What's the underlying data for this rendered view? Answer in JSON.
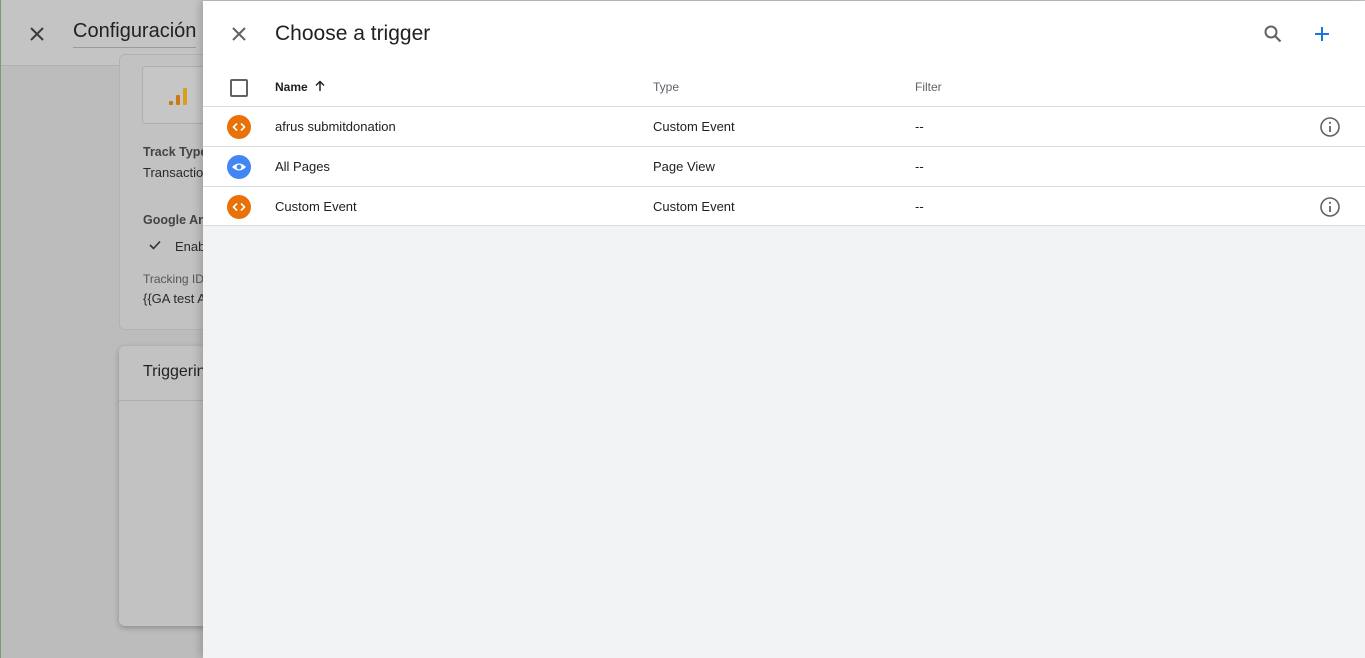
{
  "background": {
    "title": "Configuración",
    "track_type_label": "Track Type",
    "track_type_value": "Transactio",
    "ga_settings_label": "Google An",
    "enable_label": "Enab",
    "tracking_id_label": "Tracking ID",
    "tracking_id_value": "{{GA test A",
    "triggering_title": "Triggerin"
  },
  "panel": {
    "title": "Choose a trigger",
    "columns": {
      "name": "Name",
      "type": "Type",
      "filter": "Filter"
    },
    "rows": [
      {
        "name": "afrus submitdonation",
        "type": "Custom Event",
        "filter": "--",
        "icon": "code-icon",
        "icon_color": "#e8710a",
        "has_info": true
      },
      {
        "name": "All Pages",
        "type": "Page View",
        "filter": "--",
        "icon": "eye-icon",
        "icon_color": "#4285f4",
        "has_info": false
      },
      {
        "name": "Custom Event",
        "type": "Custom Event",
        "filter": "--",
        "icon": "code-icon",
        "icon_color": "#e8710a",
        "has_info": true
      }
    ]
  },
  "colors": {
    "accent": "#1a73e8",
    "custom_event": "#e8710a",
    "page_view": "#4285f4",
    "ga_bars": "#e37400"
  }
}
